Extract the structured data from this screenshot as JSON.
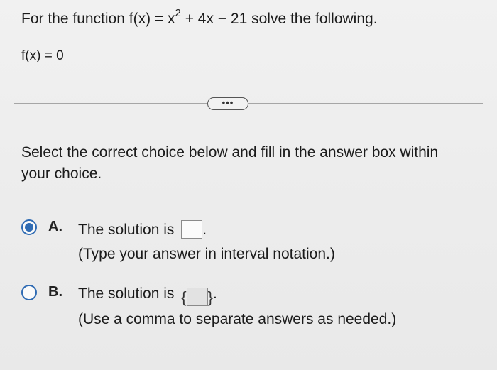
{
  "question": {
    "prefix": "For the function f(x) = x",
    "exponent": "2",
    "suffix": " + 4x − 21 solve the following.",
    "equation": "f(x) = 0"
  },
  "more_button": {
    "label": "•••"
  },
  "instructions": "Select the correct choice below and fill in the answer box within your choice.",
  "choices": [
    {
      "letter": "A.",
      "text": "The solution is",
      "end": ".",
      "hint": "(Type your answer in interval notation.)",
      "selected": true,
      "answer_value": ""
    },
    {
      "letter": "B.",
      "text": "The solution is",
      "brace_open": "{",
      "brace_close": "}",
      "end": ".",
      "hint": "(Use a comma to separate answers as needed.)",
      "selected": false,
      "answer_value": ""
    }
  ],
  "colors": {
    "radio_accent": "#2f6bb3"
  }
}
